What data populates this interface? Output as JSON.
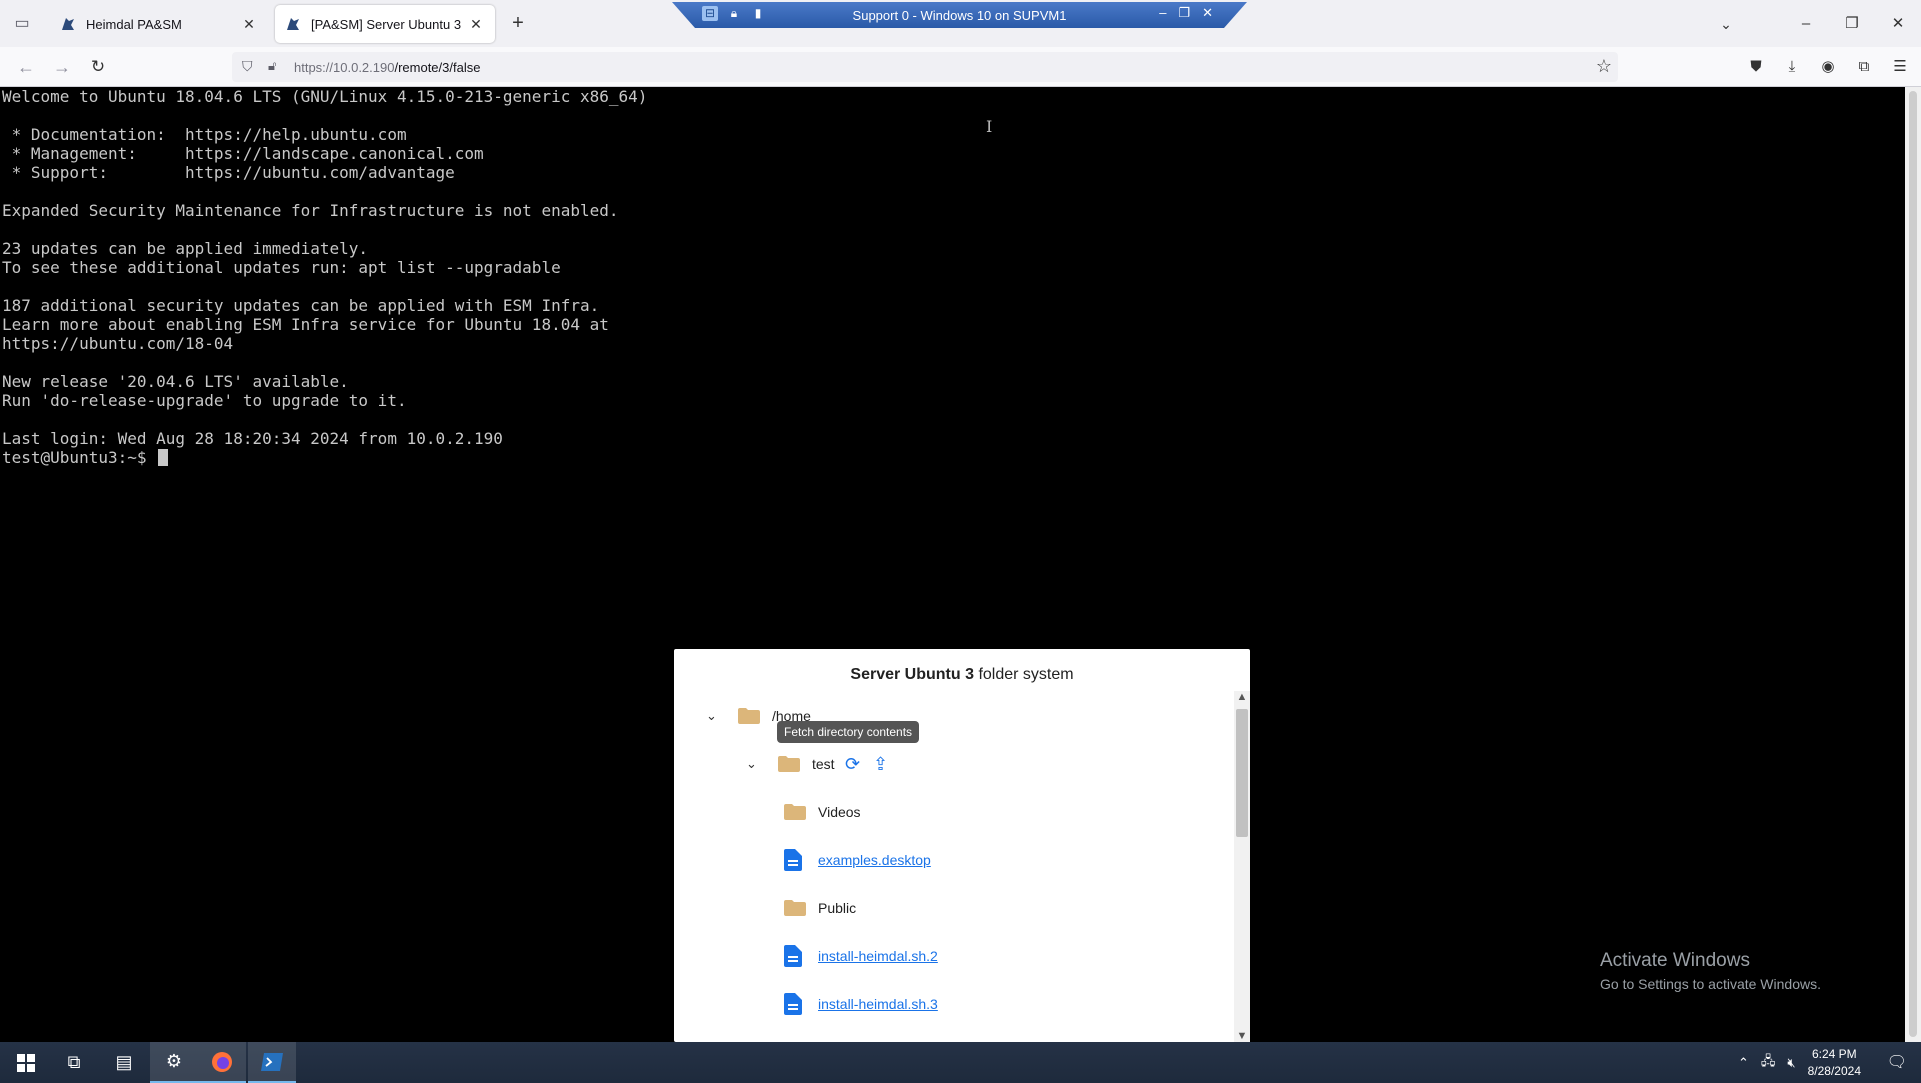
{
  "browser": {
    "tabs": [
      {
        "title": "Heimdal PA&SM",
        "active": false
      },
      {
        "title": "[PA&SM] Server Ubuntu 3",
        "active": true
      }
    ],
    "url_host": "https://10.0.2.190",
    "url_path": "/remote/3/false"
  },
  "rdp": {
    "title": "Support 0 - Windows 10 on SUPVM1"
  },
  "terminal": {
    "lines": [
      "Welcome to Ubuntu 18.04.6 LTS (GNU/Linux 4.15.0-213-generic x86_64)",
      "",
      " * Documentation:  https://help.ubuntu.com",
      " * Management:     https://landscape.canonical.com",
      " * Support:        https://ubuntu.com/advantage",
      "",
      "Expanded Security Maintenance for Infrastructure is not enabled.",
      "",
      "23 updates can be applied immediately.",
      "To see these additional updates run: apt list --upgradable",
      "",
      "187 additional security updates can be applied with ESM Infra.",
      "Learn more about enabling ESM Infra service for Ubuntu 18.04 at",
      "https://ubuntu.com/18-04",
      "",
      "New release '20.04.6 LTS' available.",
      "Run 'do-release-upgrade' to upgrade to it.",
      "",
      "Last login: Wed Aug 28 18:20:34 2024 from 10.0.2.190"
    ],
    "prompt": "test@Ubuntu3:~$ "
  },
  "folder_panel": {
    "title_bold": "Server Ubuntu 3",
    "title_rest": " folder system",
    "root": "/home",
    "tooltip": "Fetch directory contents",
    "user_dir": "test",
    "items": [
      {
        "name": "Videos",
        "kind": "folder"
      },
      {
        "name": "examples.desktop",
        "kind": "file"
      },
      {
        "name": "Public",
        "kind": "folder"
      },
      {
        "name": "install-heimdal.sh.2",
        "kind": "file"
      },
      {
        "name": "install-heimdal.sh.3",
        "kind": "file"
      }
    ]
  },
  "watermark": {
    "line1": "Activate Windows",
    "line2": "Go to Settings to activate Windows."
  },
  "taskbar": {
    "time": "6:24 PM",
    "date": "8/28/2024"
  },
  "colors": {
    "link": "#1a73e8",
    "folder": "#dcb67a",
    "terminal_text": "#c8c8c8"
  }
}
